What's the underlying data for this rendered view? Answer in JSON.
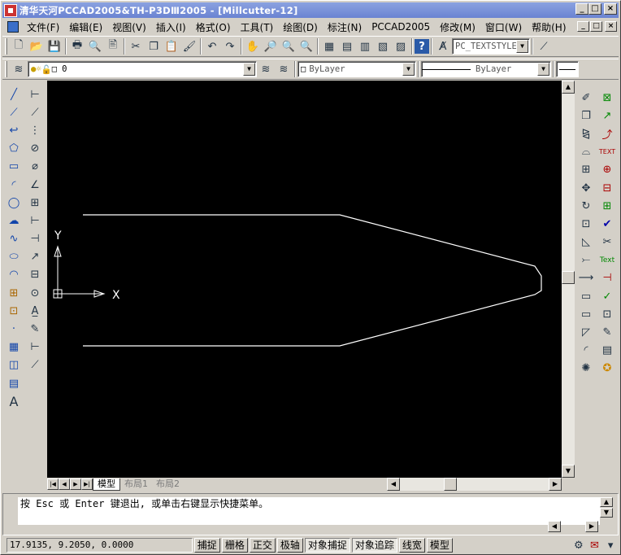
{
  "window": {
    "title": "清华天河PCCAD2005&TH-P3DⅢ2005 - [Millcutter-12]",
    "controls": [
      "_",
      "□",
      "×"
    ]
  },
  "menu": [
    "文件(F)",
    "编辑(E)",
    "视图(V)",
    "插入(I)",
    "格式(O)",
    "工具(T)",
    "绘图(D)",
    "标注(N)",
    "PCCAD2005",
    "修改(M)",
    "窗口(W)",
    "帮助(H)"
  ],
  "toolbar": {
    "textstyle": "PC_TEXTSTYLE",
    "layer": "0",
    "color": "ByLayer",
    "linetype": "ByLayer"
  },
  "ucs": {
    "x_label": "X",
    "y_label": "Y"
  },
  "tabs": [
    "模型",
    "布局1",
    "布局2"
  ],
  "command": {
    "prompt": "按 Esc 或 Enter 键退出, 或单击右键显示快捷菜单。"
  },
  "status": {
    "coords": "17.9135, 9.2050, 0.0000",
    "buttons": [
      {
        "label": "捕捉",
        "on": false
      },
      {
        "label": "栅格",
        "on": false
      },
      {
        "label": "正交",
        "on": false
      },
      {
        "label": "极轴",
        "on": false
      },
      {
        "label": "对象捕捉",
        "on": true
      },
      {
        "label": "对象追踪",
        "on": true
      },
      {
        "label": "线宽",
        "on": false
      },
      {
        "label": "模型",
        "on": false
      }
    ]
  }
}
